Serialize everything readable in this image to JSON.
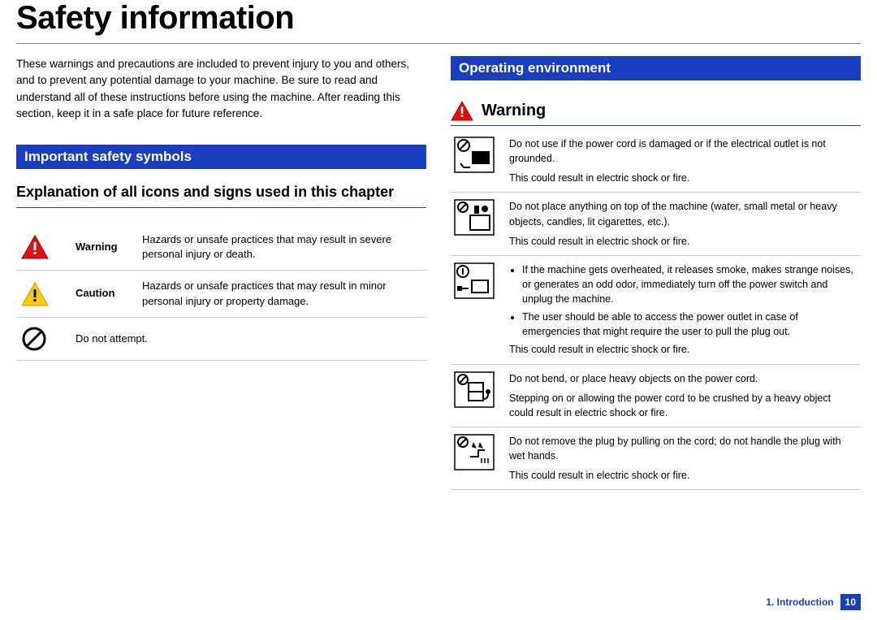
{
  "title": "Safety information",
  "intro": "These warnings and precautions are included to prevent injury to you and others, and to prevent any potential damage to your machine. Be sure to read and understand all of these instructions before using the machine. After reading this section, keep it in a safe place for future reference.",
  "sections": {
    "symbols": {
      "bar": "Important safety symbols",
      "subhead": "Explanation of all icons and signs used in this chapter",
      "rows": {
        "warning": {
          "label": "Warning",
          "desc": "Hazards or unsafe practices that may result in severe personal injury or death."
        },
        "caution": {
          "label": "Caution",
          "desc": "Hazards or unsafe practices that may result in minor personal injury or property damage."
        },
        "noattempt": {
          "desc": "Do not attempt."
        }
      }
    },
    "env": {
      "bar": "Operating environment",
      "warnhead": "Warning",
      "rows": {
        "r1": {
          "l1": "Do not use if the power cord is damaged or if the electrical outlet is not grounded.",
          "l2": "This could result in electric shock or fire."
        },
        "r2": {
          "l1": "Do not place anything on top of the machine (water, small metal or heavy objects, candles, lit cigarettes, etc.).",
          "l2": "This could result in electric shock or fire."
        },
        "r3": {
          "b1": "If the machine gets overheated, it releases smoke, makes strange noises, or generates an odd odor, immediately turn off the power switch and unplug the machine.",
          "b2": "The user should be able to access the power outlet in case of emergencies that might require the user to pull the plug out.",
          "l2": "This could result in electric shock or fire."
        },
        "r4": {
          "l1": "Do not bend, or place heavy objects on the power cord.",
          "l2": "Stepping on or allowing the power cord to be crushed by a heavy object could result in electric shock or fire."
        },
        "r5": {
          "l1": "Do not remove the plug by pulling on the cord; do not handle the plug with wet hands.",
          "l2": "This could result in electric shock or fire."
        }
      }
    }
  },
  "footer": {
    "chapter": "1. Introduction",
    "page": "10"
  }
}
